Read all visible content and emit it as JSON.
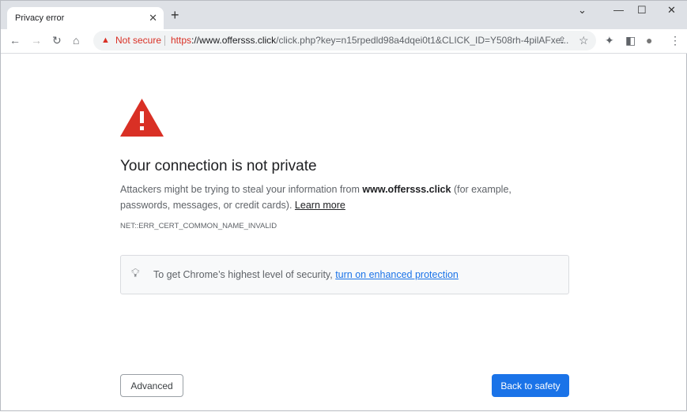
{
  "tab": {
    "title": "Privacy error",
    "close": "✕",
    "new_tab": "+"
  },
  "window": {
    "minimize": "—",
    "maximize": "☐",
    "close": "✕",
    "tab_search": "⌄"
  },
  "toolbar": {
    "back": "←",
    "forward": "→",
    "reload": "↻",
    "home": "⌂",
    "share": "⇪",
    "star": "☆",
    "extensions": "✦",
    "sidepanel": "◧",
    "profile": "●",
    "menu": "⋮"
  },
  "omnibox": {
    "warning": "▲",
    "security": "Not secure",
    "scheme": "https",
    "host": "://www.offersss.click",
    "path": "/click.php?key=n15rpedld98a4dqei0t1&CLICK_ID=Y508rh-4pilAFxe..."
  },
  "page": {
    "title": "Your connection is not private",
    "desc_prefix": "Attackers might be trying to steal your information from ",
    "domain": "www.offersss.click",
    "desc_suffix": " (for example, passwords, messages, or credit cards). ",
    "learn_more": "Learn more",
    "error_code": "NET::ERR_CERT_COMMON_NAME_INVALID",
    "tip_prefix": "To get Chrome’s highest level of security, ",
    "tip_link": "turn on enhanced protection",
    "advanced": "Advanced",
    "back_to_safety": "Back to safety"
  },
  "colors": {
    "accent": "#1a73e8",
    "danger": "#d93025"
  }
}
